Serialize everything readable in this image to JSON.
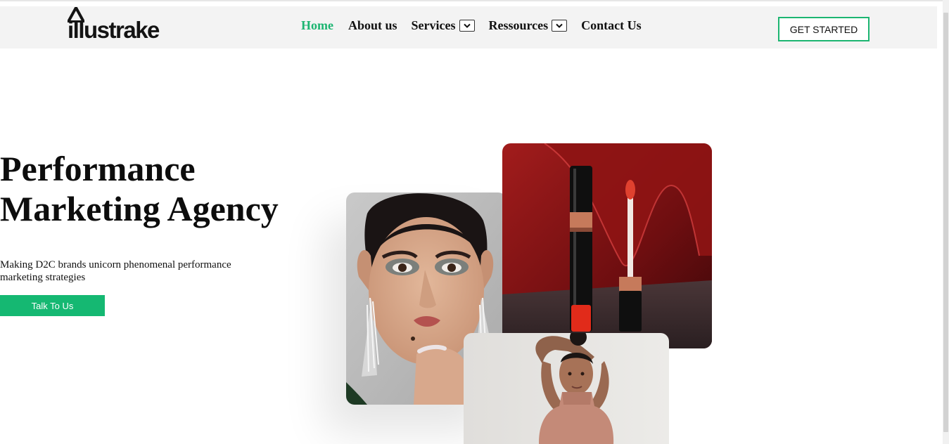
{
  "brand": {
    "name": "illustrake",
    "accent_color": "#1cb571"
  },
  "nav": {
    "items": [
      {
        "label": "Home",
        "active": true,
        "dropdown": false
      },
      {
        "label": "About us",
        "active": false,
        "dropdown": false
      },
      {
        "label": "Services",
        "active": false,
        "dropdown": true
      },
      {
        "label": "Ressources",
        "active": false,
        "dropdown": true
      },
      {
        "label": "Contact Us",
        "active": false,
        "dropdown": false
      }
    ],
    "cta_label": "GET STARTED"
  },
  "hero": {
    "title_line1": "Performance",
    "title_line2": "Marketing Agency",
    "subtitle": "Making D2C brands unicorn phenomenal performance marketing strategies",
    "button_label": "Talk To Us"
  },
  "images": {
    "left": "model-portrait-photo",
    "right": "lipstick-product-photo",
    "bottom": "model-pose-photo"
  },
  "icons": {
    "logo": "triangle-logo-icon",
    "dropdown": "chevron-down-icon"
  }
}
